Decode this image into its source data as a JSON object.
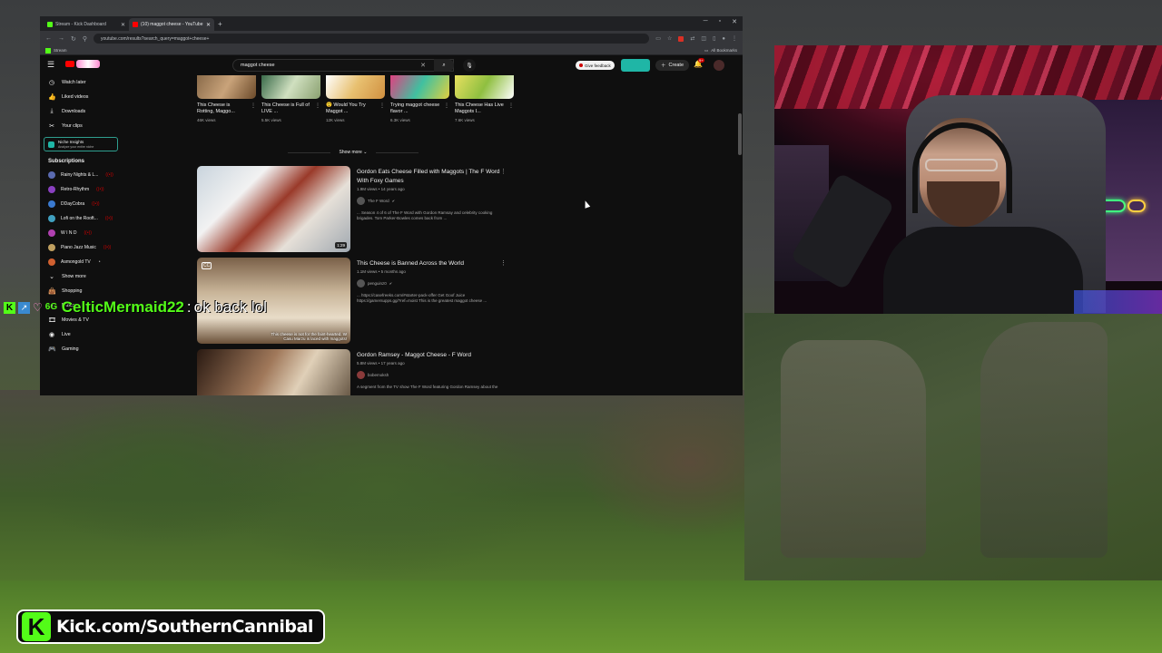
{
  "browser": {
    "tabs": [
      {
        "label": "Stream - Kick Dashboard",
        "fav_color": "#53fc18",
        "active": false
      },
      {
        "label": "(10) maggot cheese - YouTube",
        "fav_color": "#ff0000",
        "active": true
      }
    ],
    "url": "youtube.com/results?search_query=maggot+cheese+",
    "bookmark": "Stream",
    "all_bookmarks": "All Bookmarks"
  },
  "youtube": {
    "search_value": "maggot cheese",
    "feedback_label": "Give feedback",
    "create_label": "Create",
    "notification_count": "9+",
    "sidebar": {
      "top_items": [
        {
          "label": "Watch later",
          "icon": "clock-icon"
        },
        {
          "label": "Liked videos",
          "icon": "thumbs-up-icon"
        },
        {
          "label": "Downloads",
          "icon": "download-icon"
        },
        {
          "label": "Your clips",
          "icon": "scissors-icon"
        }
      ],
      "niche": {
        "title": "Niche Insights",
        "subtitle": "Analyze your entire niche"
      },
      "subscriptions_heading": "Subscriptions",
      "subscriptions": [
        {
          "label": "Rainy Nights & L...",
          "color": "#5a6ab0",
          "live": true
        },
        {
          "label": "Retro-Rhythm",
          "color": "#8a40c0",
          "live": true
        },
        {
          "label": "DDayCobra",
          "color": "#3a7ad0",
          "live": true
        },
        {
          "label": "Lofi on the Rooft...",
          "color": "#40a0c0",
          "live": true
        },
        {
          "label": "W I N D",
          "color": "#b040b0",
          "live": true
        },
        {
          "label": "Piano Jazz Music",
          "color": "#c0a060",
          "live": true
        },
        {
          "label": "Asmongold TV",
          "color": "#d06030",
          "dot": true
        }
      ],
      "show_more": "Show more",
      "explore_items": [
        {
          "label": "Shopping",
          "icon": "bag-icon"
        },
        {
          "label": "Music",
          "icon": "music-icon"
        },
        {
          "label": "Movies & TV",
          "icon": "film-icon"
        },
        {
          "label": "Live",
          "icon": "live-icon"
        },
        {
          "label": "Gaming",
          "icon": "gamepad-icon"
        }
      ]
    },
    "shorts": [
      {
        "title": "This Cheese is Rotting, Maggo...",
        "views": "46K views"
      },
      {
        "title": "This Cheese is Full of LIVE ...",
        "views": "5.5K views"
      },
      {
        "title": "😲 Would You Try Maggot ...",
        "views": "12K views"
      },
      {
        "title": "Trying maggot cheese flavor ...",
        "views": "6.3K views"
      },
      {
        "title": "This Cheese Has Live Maggots I...",
        "views": "7.6K views"
      }
    ],
    "shorts_show_more": "Show more",
    "videos": [
      {
        "title": "Gordon Eats Cheese Filled with Maggots | The F Word With Foxy Games",
        "meta": "1.9M views • 14 years ago",
        "channel": "The F Word",
        "verified": true,
        "description": "... Season 4 of 6 of The F Word with Gordon Ramsay and celebrity cooking brigades. Tom Parker-Bowles comes back from ...",
        "duration": "1:29"
      },
      {
        "title": "This Cheese is Banned Across the World",
        "meta": "1.1M views • 5 months ago",
        "channel": "penguinz0",
        "verified": true,
        "description": "... https://casefreeks.com/#starter-pack-offer Get Goof Juice https://gamersupps.gg/?ref=moist This is the greatest maggot cheese ...",
        "overlay_line1": "This cheese is not for the faint-hearted. W",
        "overlay_line2": "Casu Marzu is laced with maggots!",
        "cc": "CC"
      },
      {
        "title": "Gordon Ramsey - Maggot Cheese - F Word",
        "meta": "5.8M views • 17 years ago",
        "channel": "bobemoksh",
        "verified": false,
        "description": "A segment from the TV show The F Word featuring Gordon Ramsey about the"
      }
    ]
  },
  "chat": {
    "username": "CelticMermaid22",
    "separator": ":",
    "message": "ok back lol",
    "badges": [
      "K",
      "↗",
      "♡",
      "6G"
    ]
  },
  "banner": {
    "logo_letter": "K",
    "text": "Kick.com/SouthernCannibal"
  },
  "colors": {
    "kick_green": "#53fc18",
    "youtube_red": "#ff0000",
    "yt_bg": "#0f0f0f"
  }
}
